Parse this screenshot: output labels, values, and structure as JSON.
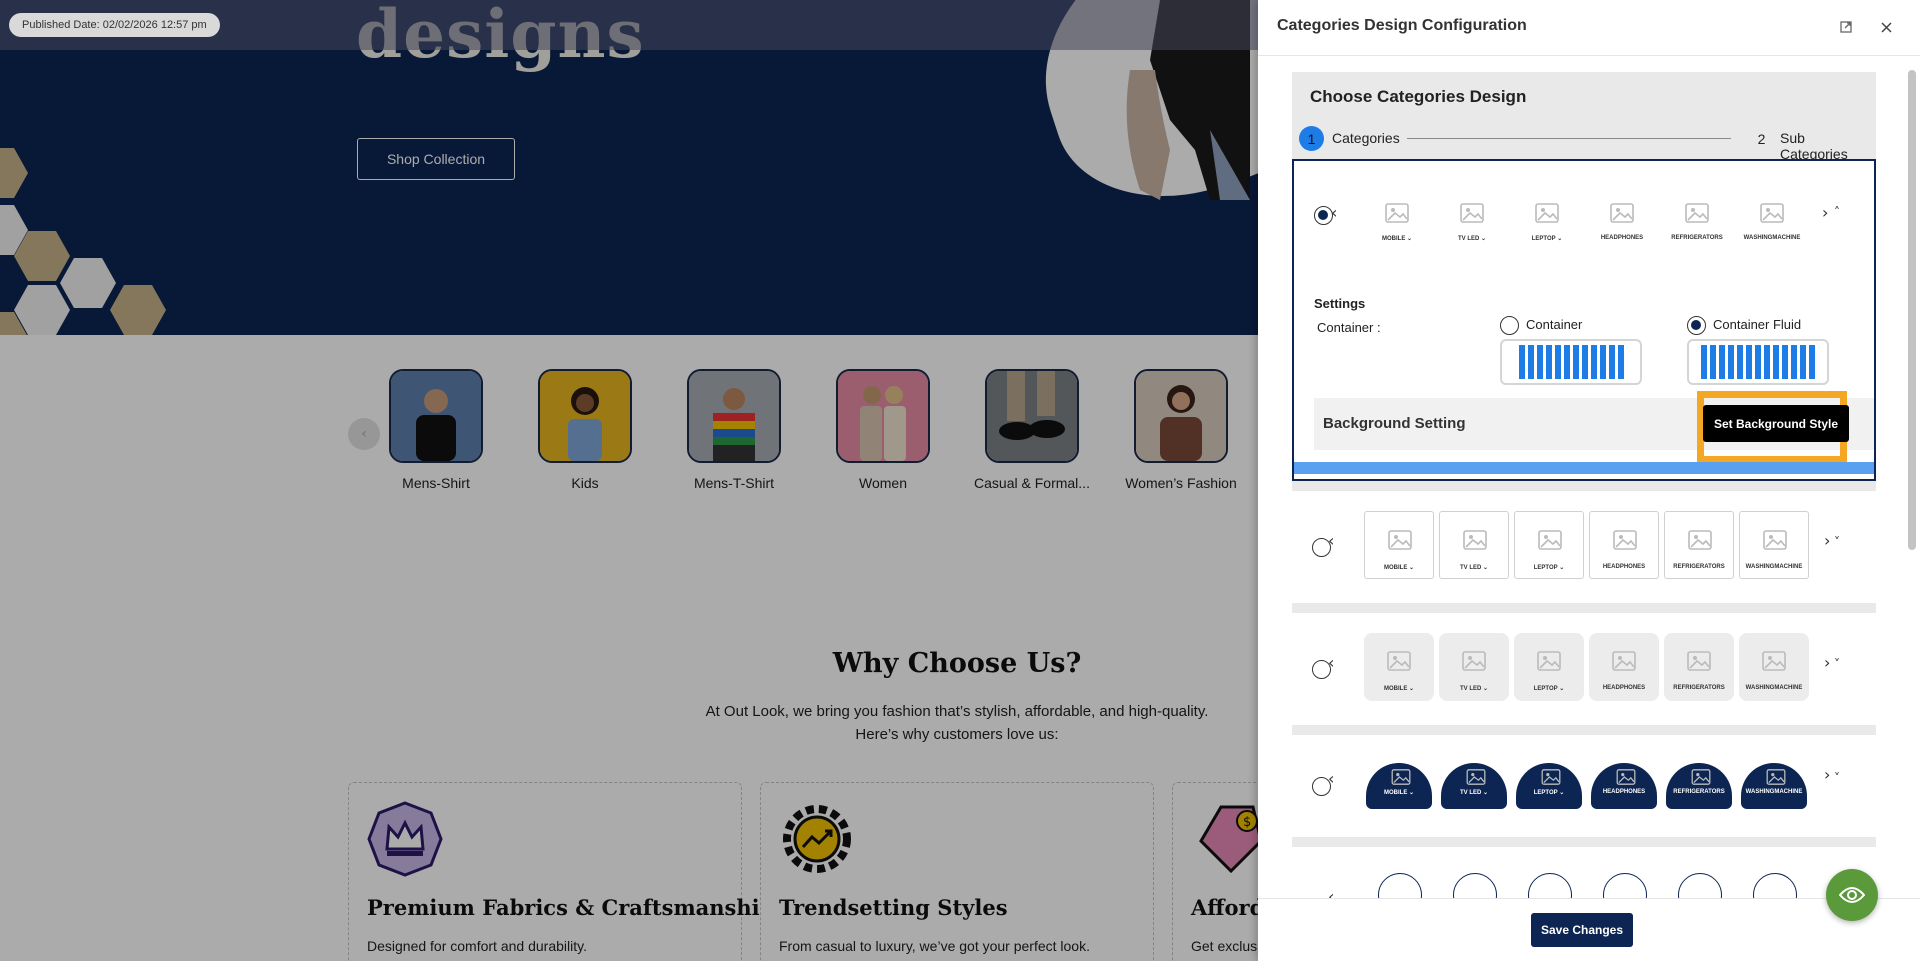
{
  "published": {
    "label": "Published Date: 02/02/2026 12:57 pm"
  },
  "hero": {
    "title": "designs",
    "cta": "Shop Collection"
  },
  "categories": [
    {
      "label": "Mens-Shirt",
      "bg": "#4a6fa5"
    },
    {
      "label": "Kids",
      "bg": "#e8b520"
    },
    {
      "label": "Mens-T-Shirt",
      "bg": "#9aa0a8"
    },
    {
      "label": "Women",
      "bg": "#e88ca6"
    },
    {
      "label": "Casual & Formal...",
      "bg": "#6d7478"
    },
    {
      "label": "Women’s Fashion",
      "bg": "#c9b7a0"
    }
  ],
  "why": {
    "title": "Why Choose Us?",
    "subtitle_line1": "At Out Look, we bring you fashion that’s stylish, affordable, and high-quality.",
    "subtitle_line2": "Here’s why customers love us:"
  },
  "features": [
    {
      "title": "Premium Fabrics & Craftsmanship",
      "text": "Designed for comfort and durability.",
      "icon": "crown-icon"
    },
    {
      "title": "Trendsetting Styles",
      "text": "From casual to luxury, we’ve got your perfect look.",
      "icon": "gear-chart-icon"
    },
    {
      "title": "Afford",
      "text": "Get exclus",
      "icon": "price-tag-icon"
    }
  ],
  "panel": {
    "title": "Categories Design Configuration",
    "choose_title": "Choose Categories Design",
    "steps": [
      {
        "num": "1",
        "label": "Categories",
        "active": true
      },
      {
        "num": "2",
        "label": "Sub Categories",
        "active": false
      }
    ],
    "tile_labels": [
      "MOBILE ⌄",
      "TV LED ⌄",
      "LEPTOP ⌄",
      "HEADPHONES",
      "REFRIGERATORS",
      "WASHINGMACHINE"
    ],
    "settings": {
      "heading": "Settings",
      "container_label": "Container :",
      "option_container": "Container",
      "option_fluid": "Container Fluid",
      "selected": "Container Fluid"
    },
    "background": {
      "label": "Background Setting",
      "button": "Set Background Style"
    },
    "save": "Save Changes"
  },
  "colors": {
    "navy": "#0c2552",
    "accent_blue": "#1d7ce6",
    "highlight": "#f5a623",
    "fab_green": "#5a9a3a"
  }
}
